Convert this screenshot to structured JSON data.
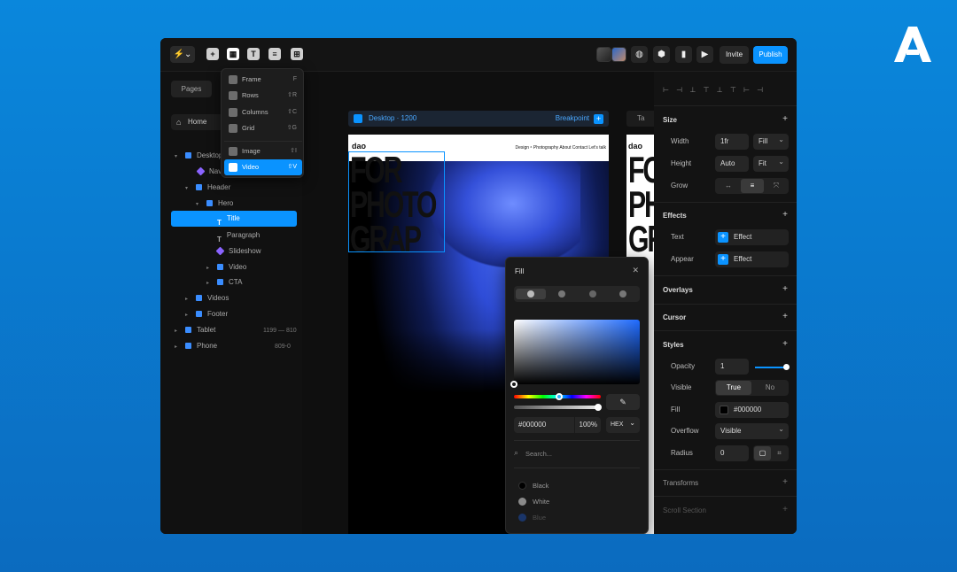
{
  "toolbar": {
    "menu_icon": "framer-logo-icon",
    "invite_label": "Invite",
    "publish_label": "Publish"
  },
  "left_panel": {
    "pages_tab": "Pages",
    "home_label": "Home",
    "layers": [
      {
        "label": "Desktop"
      },
      {
        "label": "Navi"
      },
      {
        "label": "Header"
      },
      {
        "label": "Hero"
      },
      {
        "label": "Title"
      },
      {
        "label": "Paragraph"
      },
      {
        "label": "Slideshow"
      },
      {
        "label": "Video"
      },
      {
        "label": "CTA"
      },
      {
        "label": "Videos"
      },
      {
        "label": "Footer"
      },
      {
        "label": "Tablet",
        "hint": "1199 — 810"
      },
      {
        "label": "Phone",
        "hint": "809-0"
      }
    ]
  },
  "insert_menu": {
    "items": [
      {
        "label": "Frame",
        "key": "F"
      },
      {
        "label": "Rows",
        "key": "⇧R"
      },
      {
        "label": "Columns",
        "key": "⇧C"
      },
      {
        "label": "Grid",
        "key": "⇧G"
      },
      {
        "label": "Image",
        "key": "⇧I"
      },
      {
        "label": "Video",
        "key": "⇧V"
      }
    ]
  },
  "canvas": {
    "breakpoint_label": "Desktop · 1200",
    "add_breakpoint_label": "Breakpoint",
    "tablet_label": "Ta",
    "site_logo": "dao",
    "site_nav": "Design ⁶  Photography  About  Contact  Let's talk",
    "hero_title": "FOR\nPHOTO\nGRAP",
    "tablet_title": "FO\nPH\nGR"
  },
  "fill_popover": {
    "title": "Fill",
    "hex_value": "#000000",
    "opacity_value": "100%",
    "mode": "HEX",
    "search_placeholder": "Search...",
    "swatches": [
      {
        "label": "Black",
        "color": "#000000"
      },
      {
        "label": "White",
        "color": "#ffffff"
      },
      {
        "label": "Blue",
        "color": "#1c5fe0"
      }
    ]
  },
  "properties": {
    "size_title": "Size",
    "width_label": "Width",
    "width_value": "1fr",
    "width_mode": "Fill",
    "height_label": "Height",
    "height_value": "Auto",
    "height_mode": "Fit",
    "grow_label": "Grow",
    "effects_title": "Effects",
    "text_label": "Text",
    "appear_label": "Appear",
    "effect_label": "Effect",
    "overlays_title": "Overlays",
    "cursor_title": "Cursor",
    "styles_title": "Styles",
    "opacity_label": "Opacity",
    "opacity_value": "1",
    "visible_label": "Visible",
    "visible_true": "True",
    "visible_false": "No",
    "fill_label": "Fill",
    "fill_value": "#000000",
    "overflow_label": "Overflow",
    "overflow_value": "Visible",
    "radius_label": "Radius",
    "radius_value": "0",
    "transforms_title": "Transforms",
    "scroll_title": "Scroll Section"
  },
  "colors": {
    "accent": "#0a93ff",
    "background": "#0a87dc"
  }
}
